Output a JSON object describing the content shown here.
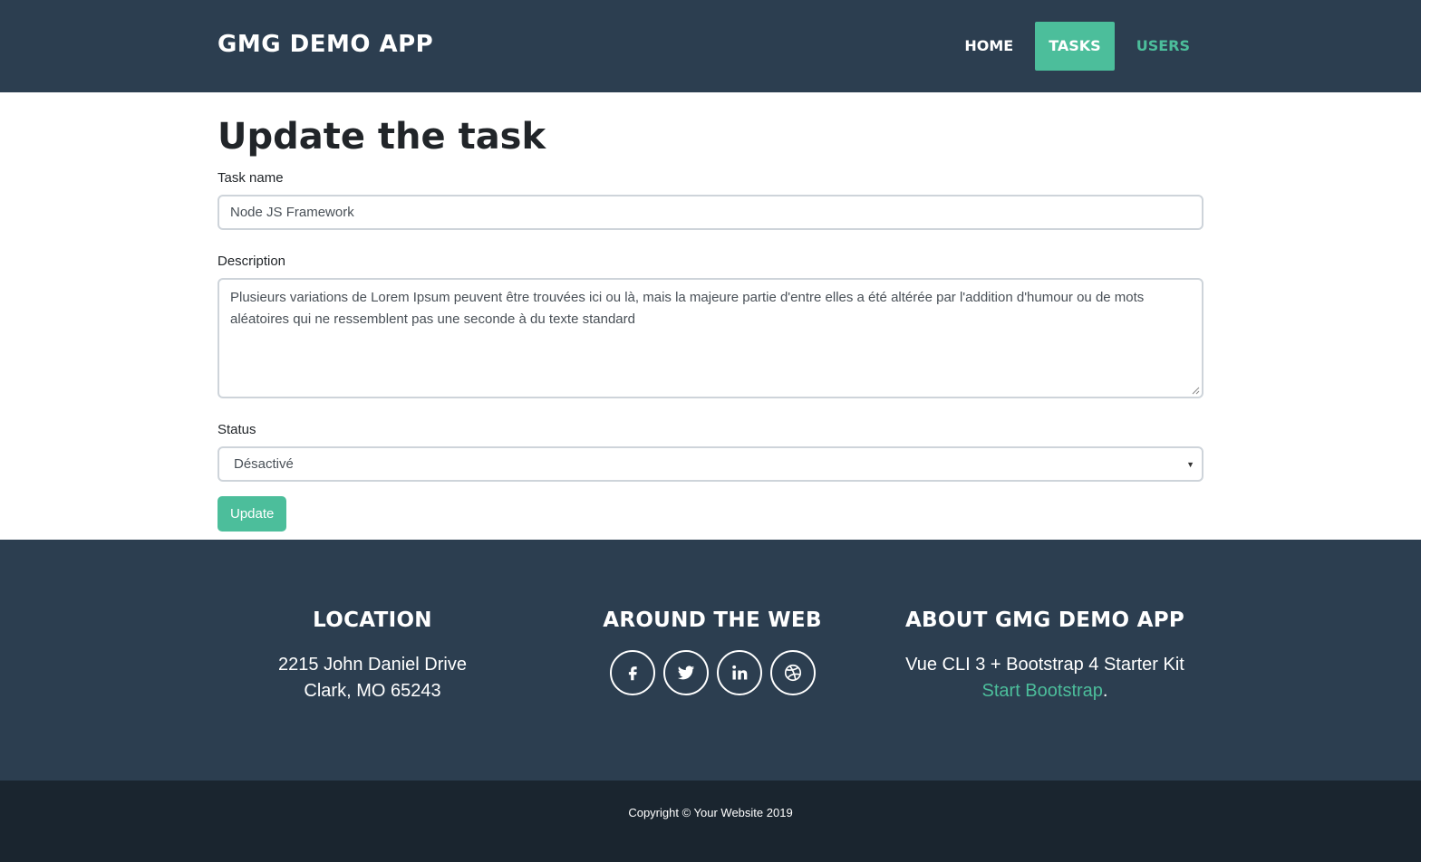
{
  "navbar": {
    "brand": "GMG DEMO APP",
    "links": [
      "HOME",
      "TASKS",
      "USERS"
    ],
    "active": "TASKS"
  },
  "form": {
    "title": "Update the task",
    "task_name_label": "Task name",
    "task_name_value": "Node JS Framework",
    "description_label": "Description",
    "description_value": "Plusieurs variations de Lorem Ipsum peuvent être trouvées ici ou là, mais la majeure partie d'entre elles a été altérée par l'addition d'humour ou de mots aléatoires qui ne ressemblent pas une seconde à du texte standard",
    "status_label": "Status",
    "status_value": "Désactivé",
    "submit_label": "Update"
  },
  "footer": {
    "location_title": "LOCATION",
    "address_line1": "2215 John Daniel Drive",
    "address_line2": "Clark, MO 65243",
    "web_title": "AROUND THE WEB",
    "socials": [
      "facebook-icon",
      "twitter-icon",
      "linkedin-icon",
      "dribbble-icon"
    ],
    "about_title": "ABOUT GMG DEMO APP",
    "about_text": "Vue CLI 3 + Bootstrap 4 Starter Kit",
    "about_link": "Start Bootstrap",
    "about_suffix": "."
  },
  "copyright": "Copyright © Your Website 2019",
  "colors": {
    "navbar_bg": "#2c3e50",
    "accent": "#4cbe9b",
    "copyright_bg": "#1a252f"
  }
}
